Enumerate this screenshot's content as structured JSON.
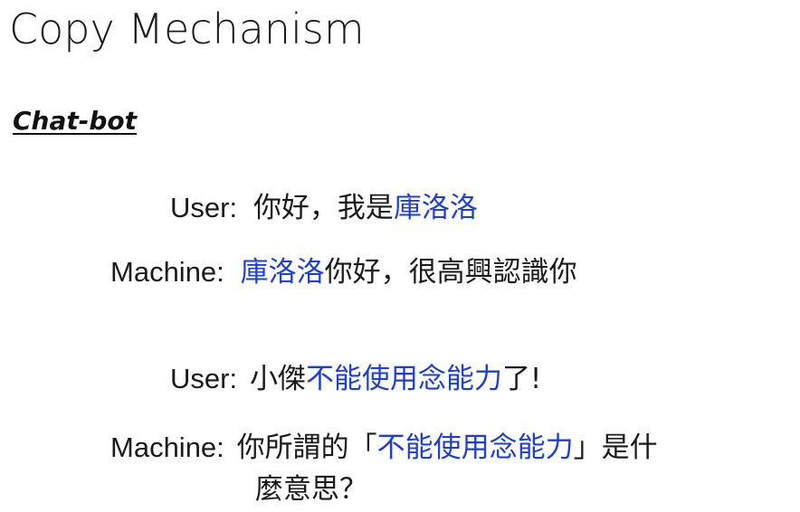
{
  "title": "Copy Mechanism",
  "subtitle": "Chat-bot",
  "dialog": [
    {
      "speaker": "User:",
      "segments": [
        {
          "text": "你好，我是",
          "highlight": false
        },
        {
          "text": "庫洛洛",
          "highlight": true
        }
      ]
    },
    {
      "speaker": "Machine:",
      "segments": [
        {
          "text": "庫洛洛",
          "highlight": true
        },
        {
          "text": "你好，很高興認識你",
          "highlight": false
        }
      ]
    },
    {
      "speaker": "User:",
      "segments": [
        {
          "text": "小傑",
          "highlight": false
        },
        {
          "text": "不能使用念能力",
          "highlight": true
        },
        {
          "text": "了!",
          "highlight": false
        }
      ]
    },
    {
      "speaker": "Machine:",
      "segments": [
        {
          "text": "你所謂的「",
          "highlight": false
        },
        {
          "text": "不能使用念能力",
          "highlight": true
        },
        {
          "text": "」是什",
          "highlight": false
        }
      ],
      "continuation": "麼意思？"
    }
  ],
  "colors": {
    "highlight": "#1f3fd0",
    "text": "#1a1a1a",
    "background": "#ffffff"
  }
}
